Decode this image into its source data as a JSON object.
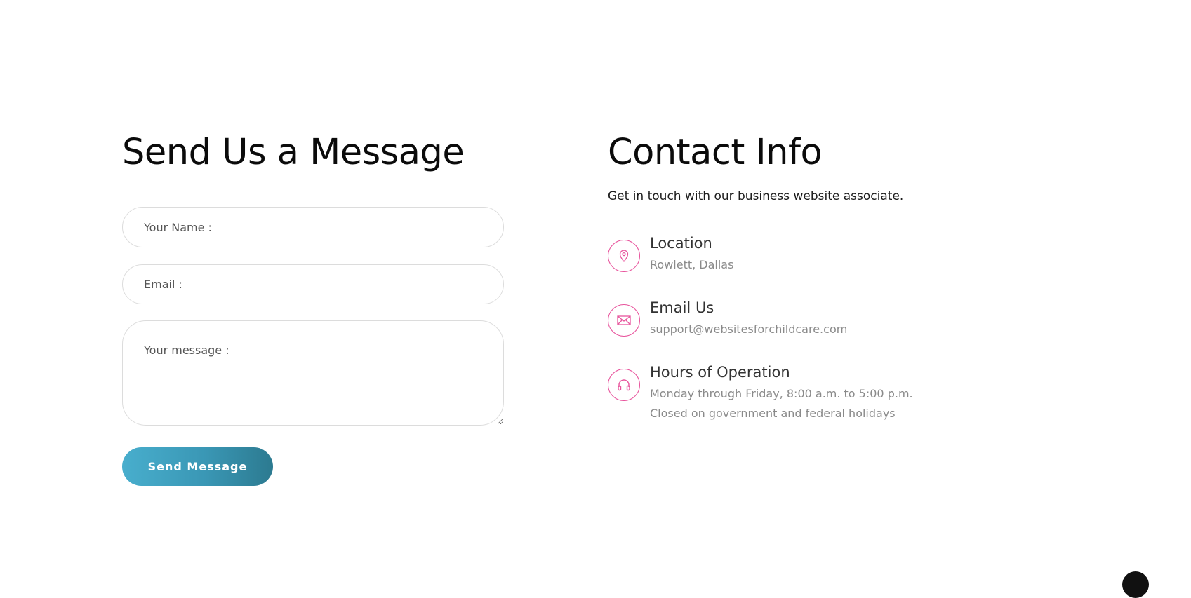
{
  "form": {
    "title": "Send Us a Message",
    "name_placeholder": "Your Name :",
    "email_placeholder": "Email :",
    "message_placeholder": "Your message :",
    "submit_label": "Send Message"
  },
  "contact": {
    "title": "Contact Info",
    "subtitle": "Get in touch with our business website associate.",
    "items": [
      {
        "icon": "map-pin-icon",
        "title": "Location",
        "lines": [
          "Rowlett, Dallas"
        ]
      },
      {
        "icon": "envelope-icon",
        "title": "Email Us",
        "lines": [
          "support@websitesforchildcare.com"
        ]
      },
      {
        "icon": "headphones-icon",
        "title": "Hours of Operation",
        "lines": [
          "Monday through Friday, 8:00 a.m. to 5:00 p.m.",
          "Closed on government and federal holidays"
        ]
      }
    ]
  },
  "colors": {
    "accent_pink": "#e8559d",
    "button_gradient_start": "#48aecd",
    "button_gradient_end": "#2c7a90"
  }
}
